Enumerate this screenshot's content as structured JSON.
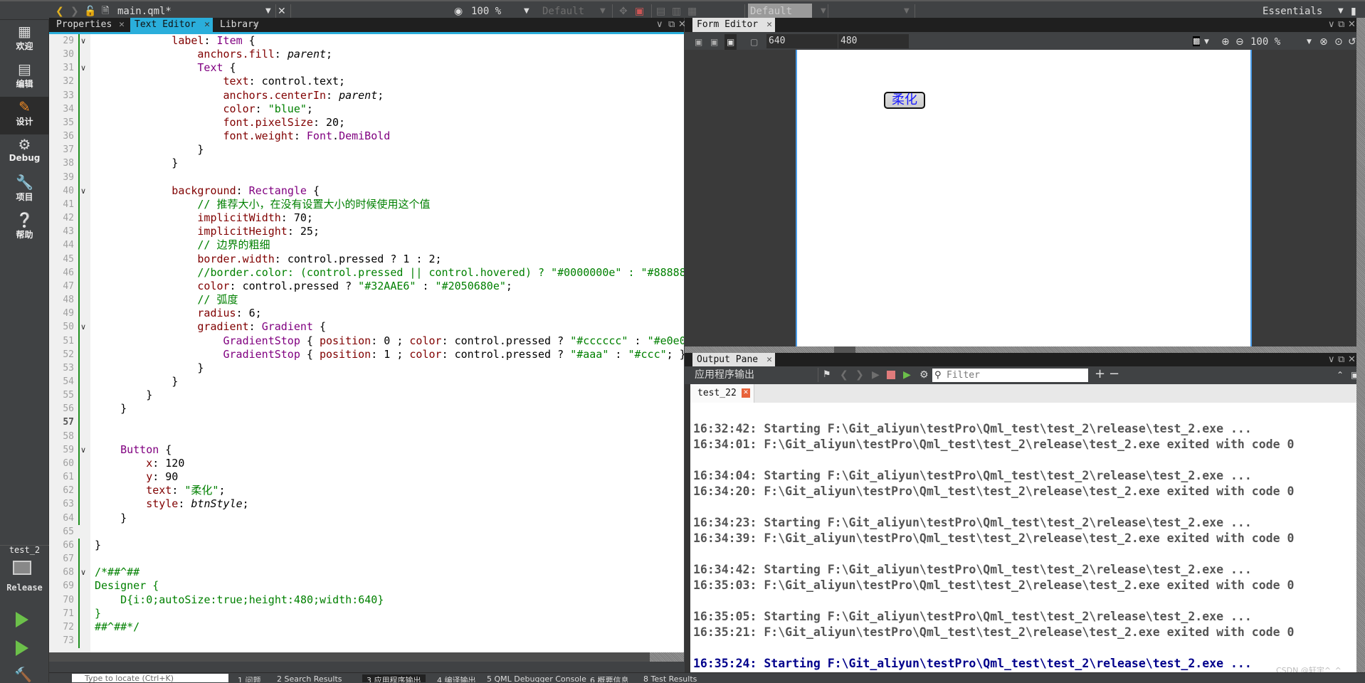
{
  "topbar": {
    "file_name": "main.qml*",
    "zoom": "100 %",
    "style_combo": "Default",
    "theme_combo": "Default",
    "workspace": "Essentials"
  },
  "sidebar": {
    "items": [
      {
        "label": "欢迎",
        "icon": "grid-icon"
      },
      {
        "label": "编辑",
        "icon": "document-icon"
      },
      {
        "label": "设计",
        "icon": "pencil-icon",
        "active": true
      },
      {
        "label": "Debug",
        "icon": "bug-icon"
      },
      {
        "label": "项目",
        "icon": "wrench-icon"
      },
      {
        "label": "帮助",
        "icon": "help-icon"
      }
    ],
    "project": "test_2",
    "build_config": "Release"
  },
  "left_tabs": [
    {
      "label": "Properties"
    },
    {
      "label": "Text Editor",
      "active": true
    },
    {
      "label": "Library"
    }
  ],
  "code": [
    {
      "n": 29,
      "i": 3,
      "fold": true,
      "t": [
        [
          "prop",
          "label"
        ],
        [
          "pl",
          ": "
        ],
        [
          "type",
          "Item"
        ],
        [
          "pl",
          " {"
        ]
      ]
    },
    {
      "n": 30,
      "i": 4,
      "t": [
        [
          "prop",
          "anchors.fill"
        ],
        [
          "pl",
          ": "
        ],
        [
          "it",
          "parent"
        ],
        [
          "pl",
          ";"
        ]
      ]
    },
    {
      "n": 31,
      "i": 4,
      "fold": true,
      "t": [
        [
          "type",
          "Text"
        ],
        [
          "pl",
          " {"
        ]
      ]
    },
    {
      "n": 32,
      "i": 5,
      "t": [
        [
          "prop",
          "text"
        ],
        [
          "pl",
          ": control.text;"
        ]
      ]
    },
    {
      "n": 33,
      "i": 5,
      "t": [
        [
          "prop",
          "anchors.centerIn"
        ],
        [
          "pl",
          ": "
        ],
        [
          "it",
          "parent"
        ],
        [
          "pl",
          ";"
        ]
      ]
    },
    {
      "n": 34,
      "i": 5,
      "t": [
        [
          "prop",
          "color"
        ],
        [
          "pl",
          ": "
        ],
        [
          "str",
          "\"blue\""
        ],
        [
          "pl",
          ";"
        ]
      ]
    },
    {
      "n": 35,
      "i": 5,
      "t": [
        [
          "prop",
          "font.pixelSize"
        ],
        [
          "pl",
          ": 20;"
        ]
      ]
    },
    {
      "n": 36,
      "i": 5,
      "t": [
        [
          "prop",
          "font.weight"
        ],
        [
          "pl",
          ": "
        ],
        [
          "type",
          "Font"
        ],
        [
          "pl",
          "."
        ],
        [
          "type",
          "DemiBold"
        ]
      ]
    },
    {
      "n": 37,
      "i": 4,
      "t": [
        [
          "pl",
          "}"
        ]
      ]
    },
    {
      "n": 38,
      "i": 3,
      "t": [
        [
          "pl",
          "}"
        ]
      ]
    },
    {
      "n": 39,
      "i": 0,
      "t": []
    },
    {
      "n": 40,
      "i": 3,
      "fold": true,
      "t": [
        [
          "prop",
          "background"
        ],
        [
          "pl",
          ": "
        ],
        [
          "type",
          "Rectangle"
        ],
        [
          "pl",
          " {"
        ]
      ]
    },
    {
      "n": 41,
      "i": 4,
      "t": [
        [
          "com",
          "// 推荐大小，在没有设置大小的时候使用这个值"
        ]
      ]
    },
    {
      "n": 42,
      "i": 4,
      "t": [
        [
          "prop",
          "implicitWidth"
        ],
        [
          "pl",
          ": 70;"
        ]
      ]
    },
    {
      "n": 43,
      "i": 4,
      "t": [
        [
          "prop",
          "implicitHeight"
        ],
        [
          "pl",
          ": 25;"
        ]
      ]
    },
    {
      "n": 44,
      "i": 4,
      "t": [
        [
          "com",
          "// 边界的粗细"
        ]
      ]
    },
    {
      "n": 45,
      "i": 4,
      "t": [
        [
          "prop",
          "border.width"
        ],
        [
          "pl",
          ": control.pressed ? 1 : 2;"
        ]
      ]
    },
    {
      "n": 46,
      "i": 4,
      "t": [
        [
          "com",
          "//border.color: (control.pressed || control.hovered) ? \"#0000000e\" : \"#88888"
        ]
      ]
    },
    {
      "n": 47,
      "i": 4,
      "t": [
        [
          "prop",
          "color"
        ],
        [
          "pl",
          ": control.pressed ? "
        ],
        [
          "str",
          "\"#32AAE6\""
        ],
        [
          "pl",
          " : "
        ],
        [
          "str",
          "\"#2050680e\""
        ],
        [
          "pl",
          ";"
        ]
      ]
    },
    {
      "n": 48,
      "i": 4,
      "t": [
        [
          "com",
          "// 弧度"
        ]
      ]
    },
    {
      "n": 49,
      "i": 4,
      "t": [
        [
          "prop",
          "radius"
        ],
        [
          "pl",
          ": 6;"
        ]
      ]
    },
    {
      "n": 50,
      "i": 4,
      "fold": true,
      "t": [
        [
          "prop",
          "gradient"
        ],
        [
          "pl",
          ": "
        ],
        [
          "type",
          "Gradient"
        ],
        [
          "pl",
          " {"
        ]
      ]
    },
    {
      "n": 51,
      "i": 5,
      "t": [
        [
          "type",
          "GradientStop"
        ],
        [
          "pl",
          " { "
        ],
        [
          "prop",
          "position"
        ],
        [
          "pl",
          ": 0 ; "
        ],
        [
          "prop",
          "color"
        ],
        [
          "pl",
          ": control.pressed ? "
        ],
        [
          "str",
          "\"#cccccc\""
        ],
        [
          "pl",
          " : "
        ],
        [
          "str",
          "\"#e0e0"
        ]
      ]
    },
    {
      "n": 52,
      "i": 5,
      "t": [
        [
          "type",
          "GradientStop"
        ],
        [
          "pl",
          " { "
        ],
        [
          "prop",
          "position"
        ],
        [
          "pl",
          ": 1 ; "
        ],
        [
          "prop",
          "color"
        ],
        [
          "pl",
          ": control.pressed ? "
        ],
        [
          "str",
          "\"#aaa\""
        ],
        [
          "pl",
          " : "
        ],
        [
          "str",
          "\"#ccc\""
        ],
        [
          "pl",
          "; }"
        ]
      ]
    },
    {
      "n": 53,
      "i": 4,
      "t": [
        [
          "pl",
          "}"
        ]
      ]
    },
    {
      "n": 54,
      "i": 3,
      "t": [
        [
          "pl",
          "}"
        ]
      ]
    },
    {
      "n": 55,
      "i": 2,
      "t": [
        [
          "pl",
          "}"
        ]
      ]
    },
    {
      "n": 56,
      "i": 1,
      "t": [
        [
          "pl",
          "}"
        ]
      ]
    },
    {
      "n": 57,
      "i": 0,
      "cur": true,
      "t": []
    },
    {
      "n": 58,
      "i": 0,
      "t": []
    },
    {
      "n": 59,
      "i": 1,
      "fold": true,
      "t": [
        [
          "type",
          "Button"
        ],
        [
          "pl",
          " {"
        ]
      ]
    },
    {
      "n": 60,
      "i": 2,
      "t": [
        [
          "prop",
          "x"
        ],
        [
          "pl",
          ": 120"
        ]
      ]
    },
    {
      "n": 61,
      "i": 2,
      "t": [
        [
          "prop",
          "y"
        ],
        [
          "pl",
          ": 90"
        ]
      ]
    },
    {
      "n": 62,
      "i": 2,
      "t": [
        [
          "prop",
          "text"
        ],
        [
          "pl",
          ": "
        ],
        [
          "str",
          "\"柔化\""
        ],
        [
          "pl",
          ";"
        ]
      ]
    },
    {
      "n": 63,
      "i": 2,
      "t": [
        [
          "prop",
          "style"
        ],
        [
          "pl",
          ": "
        ],
        [
          "it",
          "btnStyle"
        ],
        [
          "pl",
          ";"
        ]
      ]
    },
    {
      "n": 64,
      "i": 1,
      "t": [
        [
          "pl",
          "}"
        ]
      ]
    },
    {
      "n": 65,
      "i": 0,
      "t": []
    },
    {
      "n": 66,
      "i": 0,
      "t": [
        [
          "pl",
          "}"
        ]
      ]
    },
    {
      "n": 67,
      "i": 0,
      "t": []
    },
    {
      "n": 68,
      "i": 0,
      "fold": true,
      "t": [
        [
          "com",
          "/*##^##"
        ]
      ]
    },
    {
      "n": 69,
      "i": 0,
      "t": [
        [
          "com",
          "Designer {"
        ]
      ]
    },
    {
      "n": 70,
      "i": 1,
      "t": [
        [
          "com",
          "D{i:0;autoSize:true;height:480;width:640}"
        ]
      ]
    },
    {
      "n": 71,
      "i": 0,
      "t": [
        [
          "com",
          "}"
        ]
      ]
    },
    {
      "n": 72,
      "i": 0,
      "t": [
        [
          "com",
          "##^##*/"
        ]
      ]
    },
    {
      "n": 73,
      "i": 0,
      "t": []
    }
  ],
  "form_editor": {
    "tab": "Form Editor",
    "width": "640",
    "height": "480",
    "zoom": "100 %",
    "button_text": "柔化"
  },
  "output": {
    "tab": "Output Pane",
    "title": "应用程序输出",
    "filter_placeholder": "Filter",
    "run_tab": "test_22",
    "lines": [
      "16:32:42: Starting F:\\Git_aliyun\\testPro\\Qml_test\\test_2\\release\\test_2.exe ...",
      "16:34:01: F:\\Git_aliyun\\testPro\\Qml_test\\test_2\\release\\test_2.exe exited with code 0",
      "",
      "16:34:04: Starting F:\\Git_aliyun\\testPro\\Qml_test\\test_2\\release\\test_2.exe ...",
      "16:34:20: F:\\Git_aliyun\\testPro\\Qml_test\\test_2\\release\\test_2.exe exited with code 0",
      "",
      "16:34:23: Starting F:\\Git_aliyun\\testPro\\Qml_test\\test_2\\release\\test_2.exe ...",
      "16:34:39: F:\\Git_aliyun\\testPro\\Qml_test\\test_2\\release\\test_2.exe exited with code 0",
      "",
      "16:34:42: Starting F:\\Git_aliyun\\testPro\\Qml_test\\test_2\\release\\test_2.exe ...",
      "16:35:03: F:\\Git_aliyun\\testPro\\Qml_test\\test_2\\release\\test_2.exe exited with code 0",
      "",
      "16:35:05: Starting F:\\Git_aliyun\\testPro\\Qml_test\\test_2\\release\\test_2.exe ...",
      "16:35:21: F:\\Git_aliyun\\testPro\\Qml_test\\test_2\\release\\test_2.exe exited with code 0",
      "",
      "16:35:24: Starting F:\\Git_aliyun\\testPro\\Qml_test\\test_2\\release\\test_2.exe ..."
    ]
  },
  "statusbar": {
    "locator_placeholder": "Type to locate (Ctrl+K)",
    "panes": [
      "1 问题",
      "2 Search Results",
      "3 应用程序输出",
      "4 编译输出",
      "5 QML Debugger Console",
      "6 概要信息",
      "8 Test Results"
    ]
  },
  "watermark": "CSDN @轩宇^_^",
  "colors": {
    "accent": "#2aaedb",
    "prop": "#800000",
    "type": "#800080",
    "string": "#008000",
    "running_line": "#00008b"
  }
}
